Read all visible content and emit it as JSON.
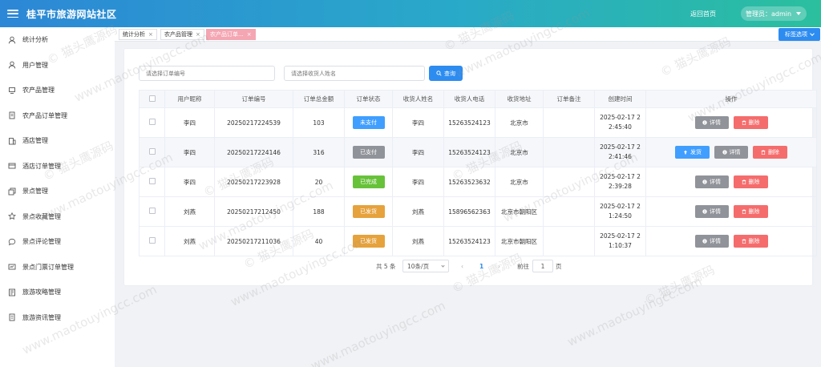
{
  "header": {
    "title": "桂平市旅游网站社区",
    "home_link": "返回首页",
    "admin_label": "管理员：admin"
  },
  "sidebar": {
    "items": [
      {
        "label": "统计分析",
        "icon": "user-icon"
      },
      {
        "label": "用户管理",
        "icon": "user-icon"
      },
      {
        "label": "农产品管理",
        "icon": "product-icon"
      },
      {
        "label": "农产品订单管理",
        "icon": "order-icon"
      },
      {
        "label": "酒店管理",
        "icon": "hotel-icon"
      },
      {
        "label": "酒店订单管理",
        "icon": "card-icon"
      },
      {
        "label": "景点管理",
        "icon": "copy-icon"
      },
      {
        "label": "景点收藏管理",
        "icon": "star-icon"
      },
      {
        "label": "景点评论管理",
        "icon": "comment-icon"
      },
      {
        "label": "景点门票订单管理",
        "icon": "ticket-icon"
      },
      {
        "label": "旅游攻略管理",
        "icon": "guide-icon"
      },
      {
        "label": "旅游资讯管理",
        "icon": "news-icon"
      }
    ]
  },
  "tabs": [
    {
      "label": "统计分析",
      "close": "×"
    },
    {
      "label": "农产品管理",
      "close": "×"
    },
    {
      "label": "农产品订单...",
      "close": "×",
      "active": true
    }
  ],
  "tag_options_label": "标签选项",
  "search": {
    "order_no_placeholder": "请选择订单编号",
    "receiver_placeholder": "请选择收货人姓名",
    "button_label": "查询"
  },
  "table": {
    "headers": [
      "",
      "用户昵称",
      "订单编号",
      "订单总金额",
      "订单状态",
      "收货人姓名",
      "收货人电话",
      "收货地址",
      "订单备注",
      "创建时间",
      "操作"
    ],
    "detail_label": "详情",
    "delete_label": "删除",
    "ship_label": "发货",
    "rows": [
      {
        "nickname": "李四",
        "order_no": "20250217224539",
        "amount": "103",
        "status": "未支付",
        "status_type": "unpaid",
        "receiver": "李四",
        "phone": "15263524123",
        "address": "北京市",
        "note": "",
        "time1": "2025-02-17 2",
        "time2": "2:45:40",
        "ship": false
      },
      {
        "nickname": "李四",
        "order_no": "20250217224146",
        "amount": "316",
        "status": "已支付",
        "status_type": "paid",
        "receiver": "李四",
        "phone": "15263524123",
        "address": "北京市",
        "note": "",
        "time1": "2025-02-17 2",
        "time2": "2:41:46",
        "ship": true
      },
      {
        "nickname": "李四",
        "order_no": "20250217223928",
        "amount": "20",
        "status": "已完成",
        "status_type": "done",
        "receiver": "李四",
        "phone": "15263523632",
        "address": "北京市",
        "note": "",
        "time1": "2025-02-17 2",
        "time2": "2:39:28",
        "ship": false
      },
      {
        "nickname": "刘燕",
        "order_no": "20250217212450",
        "amount": "188",
        "status": "已发货",
        "status_type": "shipped",
        "receiver": "刘燕",
        "phone": "15896562363",
        "address": "北京市朝阳区",
        "note": "",
        "time1": "2025-02-17 2",
        "time2": "1:24:50",
        "ship": false
      },
      {
        "nickname": "刘燕",
        "order_no": "20250217211036",
        "amount": "40",
        "status": "已发货",
        "status_type": "shipped",
        "receiver": "刘燕",
        "phone": "15263524123",
        "address": "北京市朝阳区",
        "note": "",
        "time1": "2025-02-17 2",
        "time2": "1:10:37",
        "ship": false
      }
    ]
  },
  "pagination": {
    "total": "共 5 条",
    "page_size": "10条/页",
    "prev": "‹",
    "current_page": "1",
    "next": "›",
    "goto_label": "前往",
    "goto_value": "1",
    "page_suffix": "页"
  },
  "watermark": {
    "cn": "© 猫头鹰源码",
    "url": "www.maotouyingcc.com"
  }
}
